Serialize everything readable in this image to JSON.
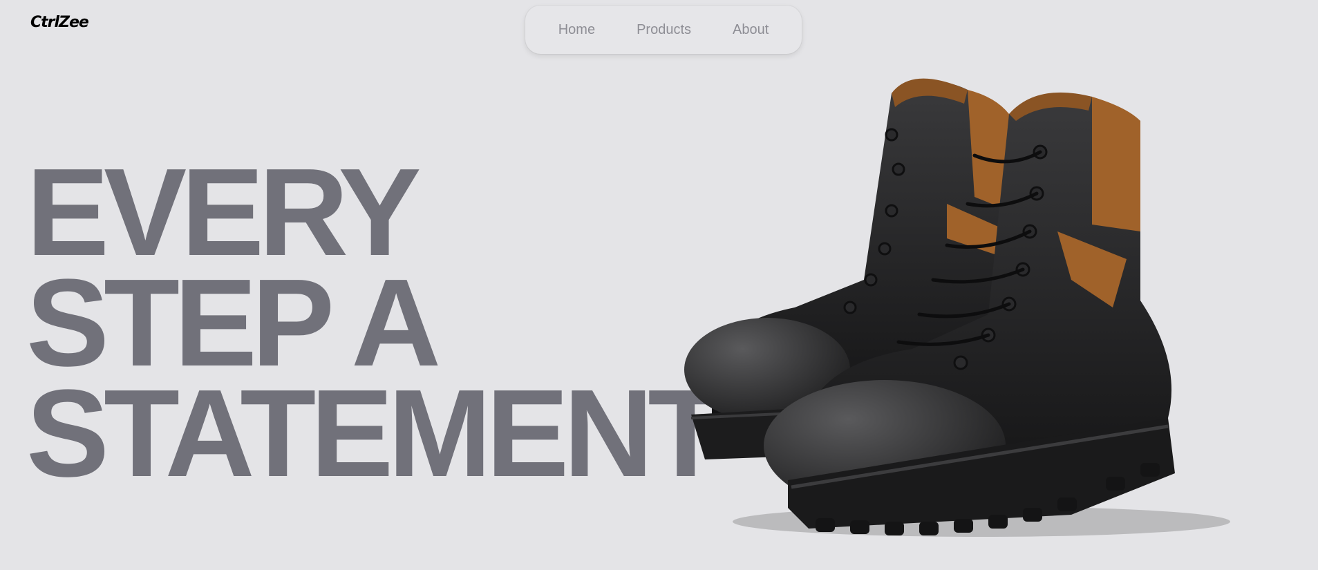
{
  "header": {
    "logo": "CtrlZee",
    "nav": [
      "Home",
      "Products",
      "About"
    ]
  },
  "hero": {
    "lines": [
      "EVERY",
      "STEP A",
      "STATEMENT"
    ]
  },
  "image": {
    "icon": "boots-product-image",
    "colors": {
      "leather": "#2a2a2c",
      "accent": "#a0622a"
    }
  }
}
